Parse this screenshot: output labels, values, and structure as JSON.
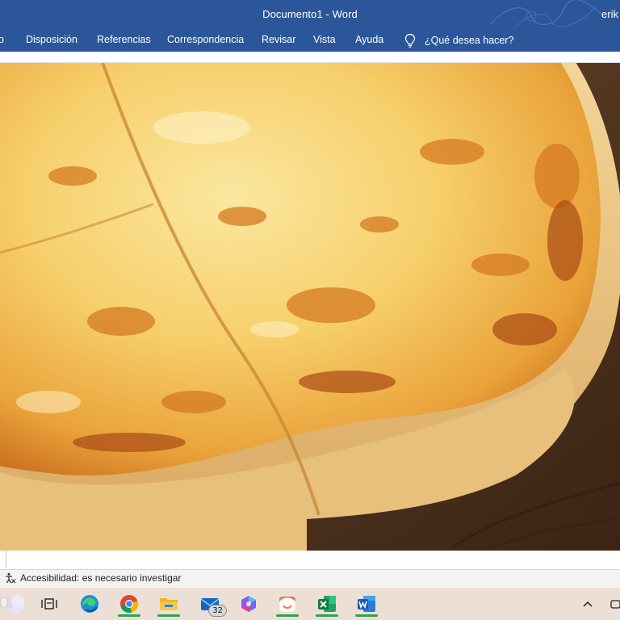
{
  "window": {
    "title": "Documento1  -  Word",
    "user": "erik"
  },
  "ribbon": {
    "tabs": [
      {
        "label": "o"
      },
      {
        "label": "Disposición"
      },
      {
        "label": "Referencias"
      },
      {
        "label": "Correspondencia"
      },
      {
        "label": "Revisar"
      },
      {
        "label": "Vista"
      },
      {
        "label": "Ayuda"
      }
    ],
    "tell_me": "¿Qué desea hacer?"
  },
  "document": {
    "image_icon": "cheese-pizza-photo"
  },
  "status_bar": {
    "accessibility": "Accesibilidad: es necesario investigar"
  },
  "taskbar": {
    "mail_badge": "32",
    "items": [
      "widgets-icon",
      "task-view-icon",
      "edge-icon",
      "chrome-icon",
      "file-explorer-icon",
      "mail-icon",
      "copilot-icon",
      "app-icon",
      "excel-icon",
      "word-icon"
    ],
    "tray": [
      "chevron-up-icon",
      "camera-icon"
    ]
  },
  "colors": {
    "ribbon": "#2b579a",
    "taskbar": "#ecdfd6",
    "status_bar": "#f3f3f3",
    "active_indicator": "#2da44e"
  }
}
